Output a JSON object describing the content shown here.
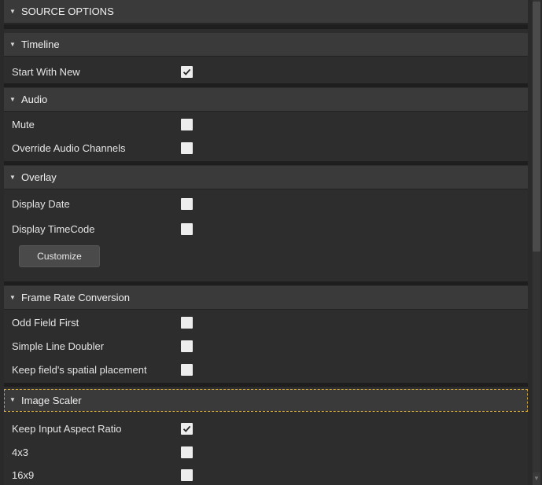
{
  "panel": {
    "title": "SOURCE OPTIONS",
    "sections": {
      "timeline": {
        "title": "Timeline",
        "start_with_new": {
          "label": "Start With New",
          "checked": true
        }
      },
      "audio": {
        "title": "Audio",
        "mute": {
          "label": "Mute",
          "checked": false
        },
        "override_channels": {
          "label": "Override Audio Channels",
          "checked": false
        }
      },
      "overlay": {
        "title": "Overlay",
        "display_date": {
          "label": "Display Date",
          "checked": false
        },
        "display_timecode": {
          "label": "Display TimeCode",
          "checked": false
        },
        "customize_label": "Customize"
      },
      "frame_rate": {
        "title": "Frame Rate Conversion",
        "odd_field_first": {
          "label": "Odd Field First",
          "checked": false
        },
        "simple_line_doubler": {
          "label": "Simple Line Doubler",
          "checked": false
        },
        "keep_spatial": {
          "label": "Keep field's spatial placement",
          "checked": false
        }
      },
      "image_scaler": {
        "title": "Image Scaler",
        "keep_aspect": {
          "label": "Keep Input Aspect Ratio",
          "checked": true
        },
        "ratio_4x3": {
          "label": "4x3",
          "checked": false
        },
        "ratio_16x9": {
          "label": "16x9",
          "checked": false
        }
      }
    }
  },
  "icons": {
    "expand": "triangle-down-icon",
    "check": "checkmark-icon"
  },
  "colors": {
    "background": "#2d2d2d",
    "header": "#3a3a3a",
    "checkbox": "#ededed",
    "focus_outline": "#c9a23c"
  }
}
